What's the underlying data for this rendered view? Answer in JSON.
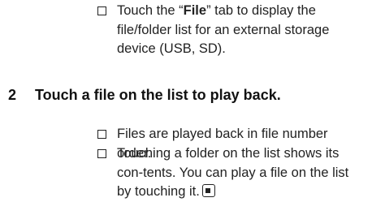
{
  "note1": {
    "prefix": "Touch the “",
    "tab_name": "File",
    "suffix": "” tab to display the file/folder list for an external storage device (USB, SD)."
  },
  "step2": {
    "number": "2",
    "text": "Touch a file on the list to play back."
  },
  "note2": {
    "text": "Files are played back in file number order."
  },
  "note3": {
    "text": "Touching a folder on the list shows its con-tents. You can play a file on the list by touching it."
  },
  "icons": {
    "bullet": "checkbox-bullet-icon",
    "end": "end-of-section-icon"
  }
}
